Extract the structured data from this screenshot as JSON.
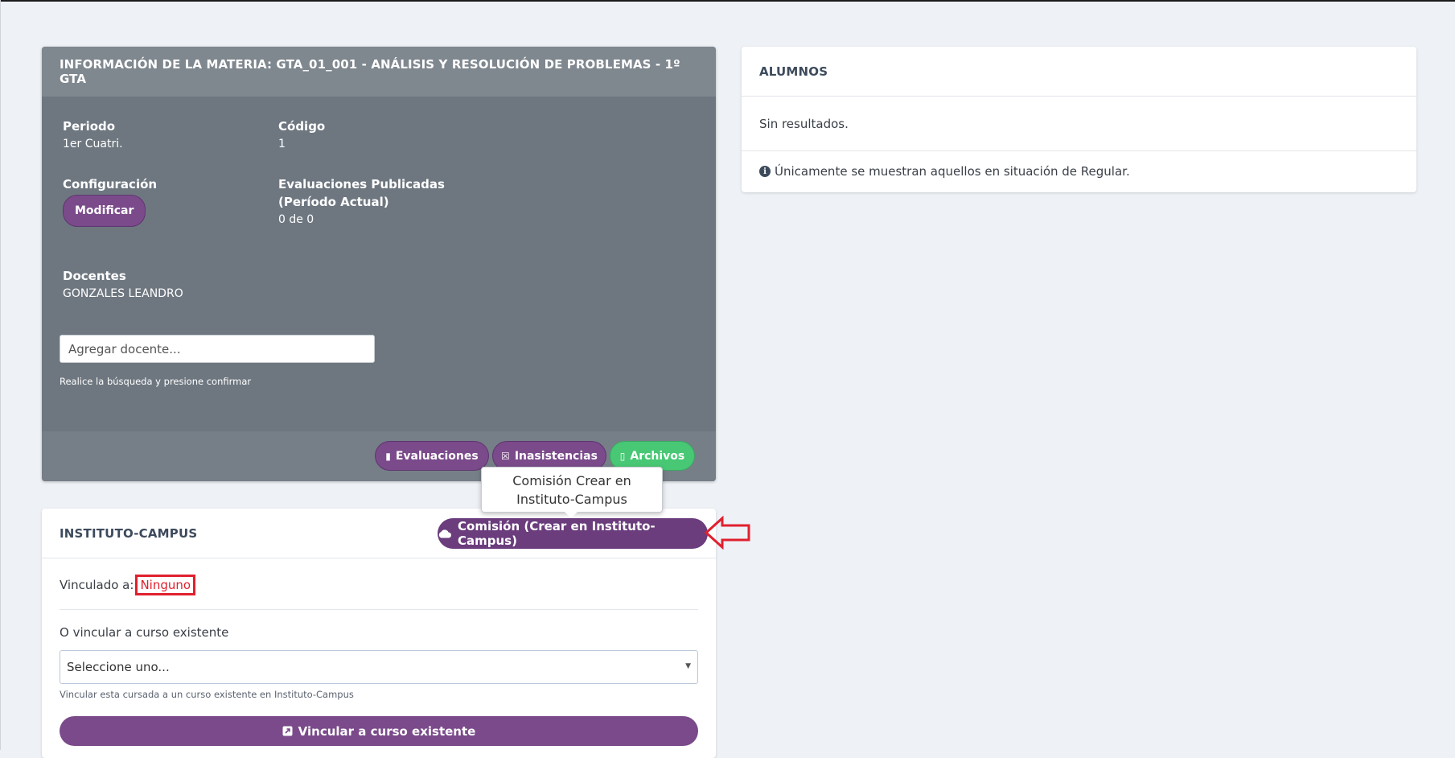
{
  "materia": {
    "title": "INFORMACIÓN DE LA MATERIA: GTA_01_001 - ANÁLISIS Y RESOLUCIÓN DE PROBLEMAS - 1º GTA",
    "periodo_label": "Periodo",
    "periodo_value": "1er Cuatri.",
    "codigo_label": "Código",
    "codigo_value": "1",
    "config_label": "Configuración",
    "modificar_label": "Modificar",
    "evaluaciones_label_1": "Evaluaciones Publicadas",
    "evaluaciones_label_2": "(Período Actual)",
    "evaluaciones_value": "0 de 0",
    "docentes_label": "Docentes",
    "docentes_value": "GONZALES LEANDRO",
    "docente_placeholder": "Agregar docente...",
    "docente_help": "Realice la búsqueda y presione confirmar",
    "buttons": {
      "evaluaciones": "Evaluaciones",
      "inasistencias": "Inasistencias",
      "archivos": "Archivos"
    }
  },
  "tooltip": {
    "text": "Comisión Crear en Instituto-Campus"
  },
  "instituto": {
    "title": "INSTITUTO-CAMPUS",
    "comision_button": "Comisión (Crear en Instituto-Campus)",
    "vinculado_label": "Vinculado a:",
    "vinculado_value": "Ninguno",
    "o_vincular_label": "O vincular a curso existente",
    "select_value": "Seleccione uno...",
    "select_help": "Vincular esta cursada a un curso existente en Instituto-Campus",
    "vincular_button": "Vincular a curso existente"
  },
  "alumnos": {
    "title": "ALUMNOS",
    "empty": "Sin resultados.",
    "note": "Únicamente se muestran aquellos en situación de Regular."
  },
  "colors": {
    "purple": "#7a4a8a",
    "green": "#48c774",
    "highlight_red": "#e0202e",
    "card_gray": "#6e7780"
  }
}
